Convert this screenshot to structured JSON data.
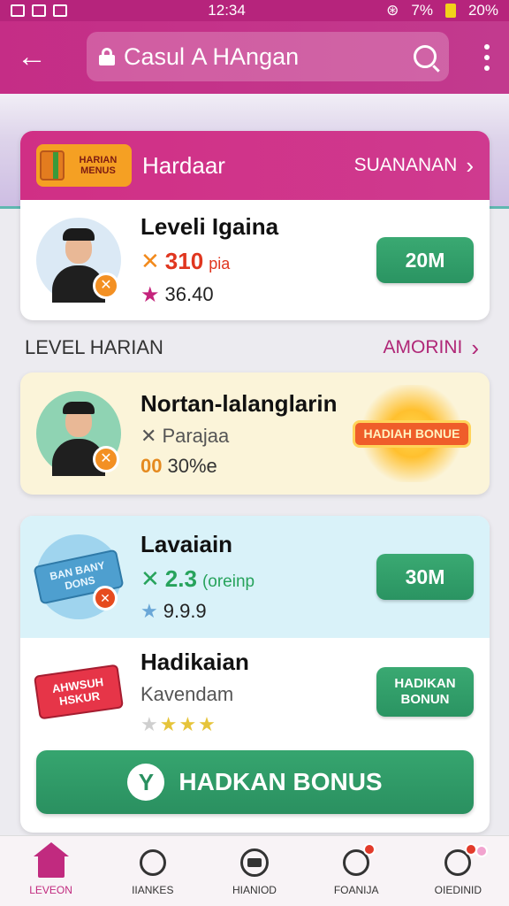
{
  "status_bar": {
    "time": "12:34",
    "battery": "7%",
    "signal": "20%"
  },
  "header": {
    "title": "Casul A HAngan"
  },
  "card1": {
    "header_title": "Hardaar",
    "header_link": "SUANANAN",
    "badge_text": "HARIAN MENUS",
    "item_title": "Leveli Igaina",
    "points_value": "310",
    "points_unit": "pia",
    "rating": "36.40",
    "button": "20M"
  },
  "section": {
    "title": "LEVEL HARIAN",
    "link": "AMORINI"
  },
  "card2": {
    "item_title": "Nortan-lalanglarin",
    "subtitle": "Parajaa",
    "progress": "30%e",
    "progress_prefix": "00",
    "promo_text": "HADIAH BONUE"
  },
  "card3": {
    "item_title": "Lavaiain",
    "icon_text": "BAN BANY DONS",
    "value": "2.3",
    "unit": "(oreinp",
    "rating": "9.9.9",
    "button": "30M",
    "item2_title": "Hadikaian",
    "item2_subtitle": "Kavendam",
    "item2_ticket": "AHWSUH HSKUR",
    "item2_button": "HADIKAN BONUN",
    "bonus_button": "HADKAN BONUS"
  },
  "nav": [
    {
      "label": "LEVEON",
      "icon": "home-icon"
    },
    {
      "label": "IIANKES",
      "icon": "search-icon"
    },
    {
      "label": "HIANIOD",
      "icon": "gamepad-icon"
    },
    {
      "label": "FOANIJA",
      "icon": "coin-icon"
    },
    {
      "label": "OIEDINID",
      "icon": "profile-icon"
    }
  ],
  "colors": {
    "primary": "#c52d86",
    "accent_green": "#2a9462",
    "orange": "#f28a1c"
  }
}
